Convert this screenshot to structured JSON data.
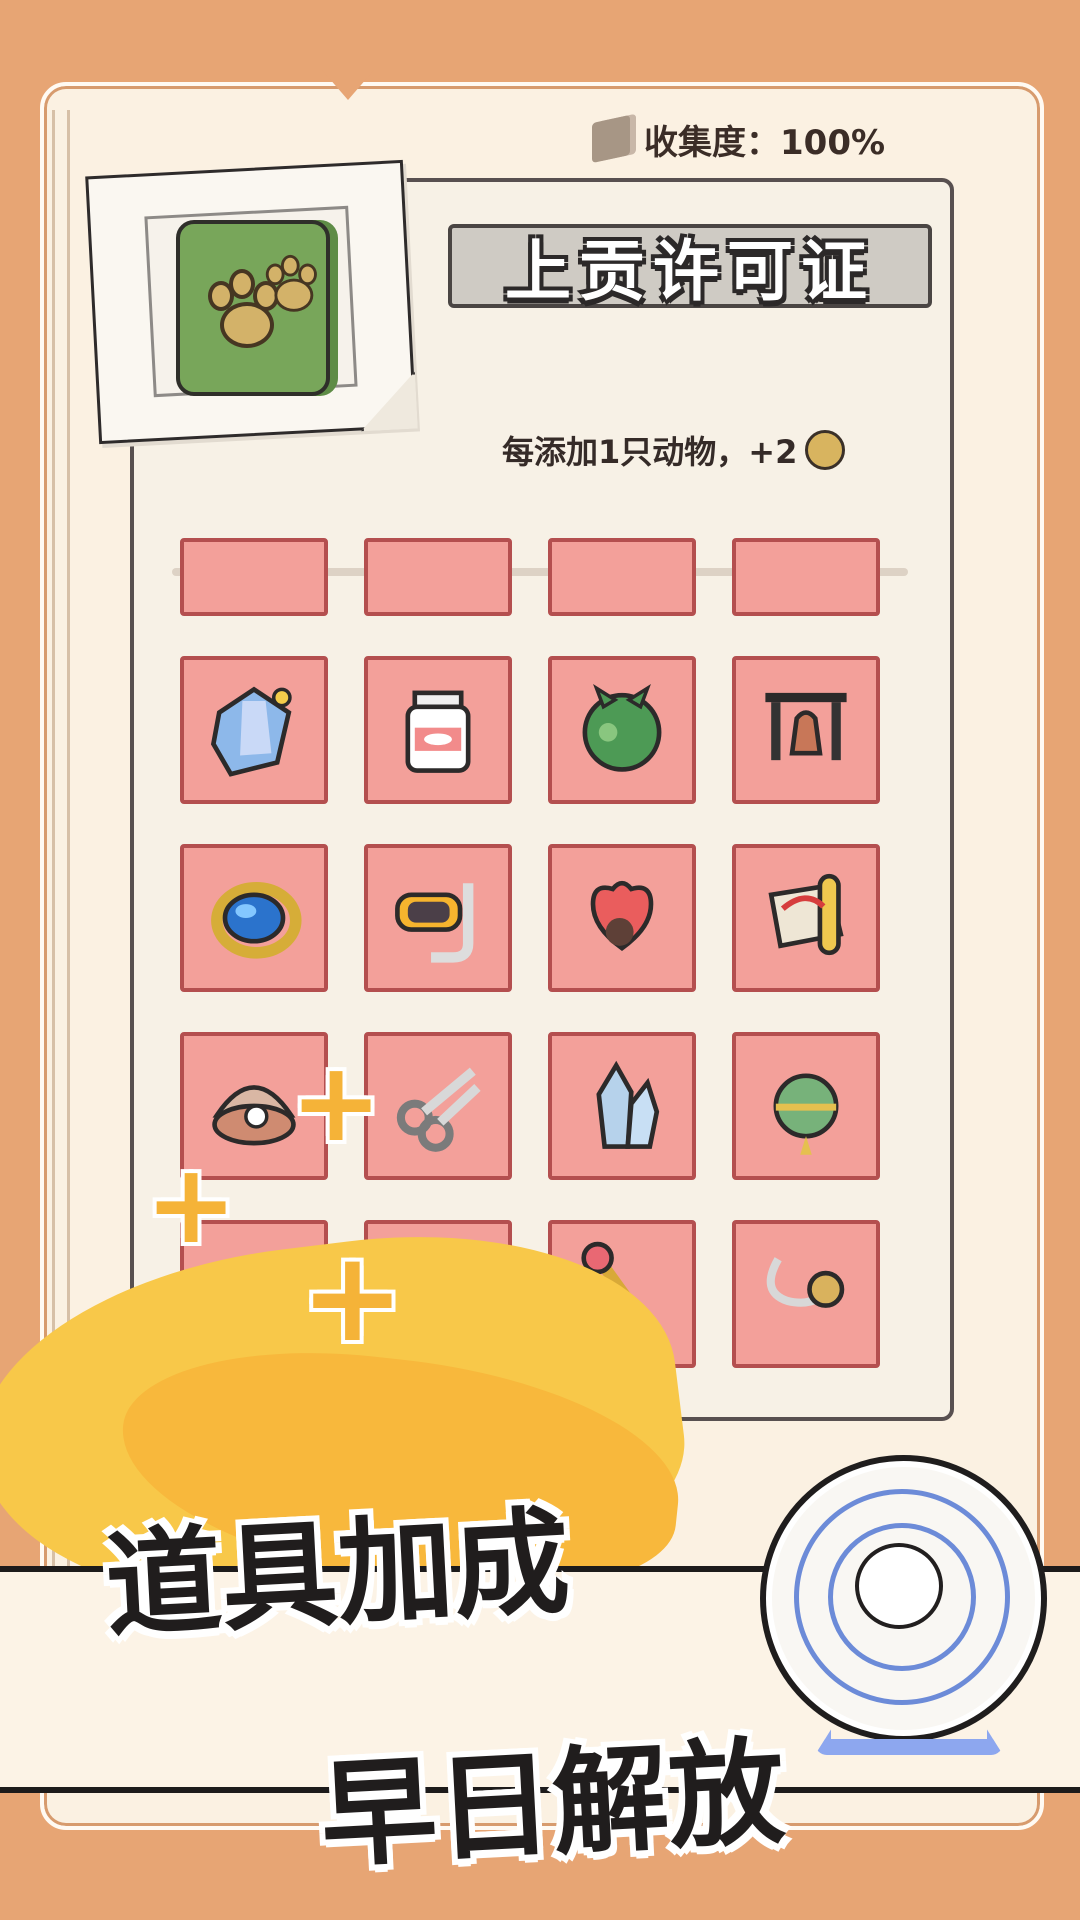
{
  "collection": {
    "label": "收集度：100%"
  },
  "item": {
    "title": "上贡许可证",
    "effect": "每添加1只动物，+2",
    "icon": "paw-permit-icon"
  },
  "grid_icons": [
    "crystal-icon",
    "treat-jar-icon",
    "green-orb-icon",
    "wind-chime-icon",
    "sapphire-ring-icon",
    "snorkel-mask-icon",
    "heart-toy-icon",
    "scroll-icon",
    "pearl-shell-icon",
    "scissors-icon",
    "quartz-crystal-icon",
    "bell-icon",
    "herb-jar-icon",
    "card-icon",
    "magic-wand-icon",
    "key-chain-icon"
  ],
  "headline": {
    "line1": "道具加成",
    "line2": "早日解放"
  },
  "colors": {
    "background": "#e7a574",
    "tile": "#f3a09a",
    "tile_border": "#b44f4f",
    "accent_yellow": "#f8c849"
  }
}
